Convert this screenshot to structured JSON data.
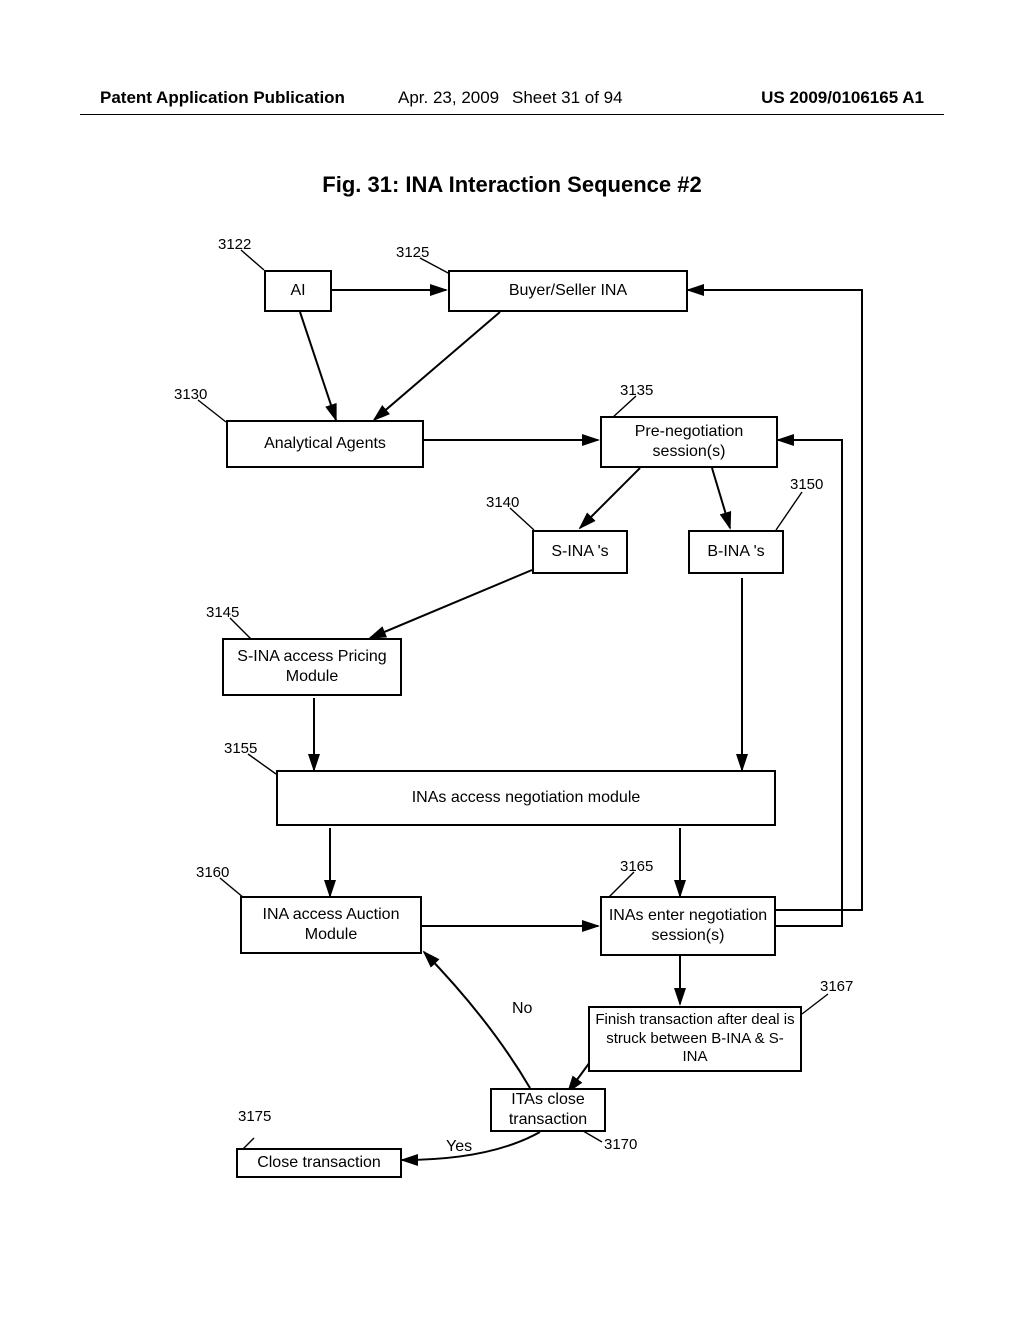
{
  "header": {
    "publication": "Patent Application Publication",
    "date": "Apr. 23, 2009",
    "sheet": "Sheet 31 of 94",
    "number": "US 2009/0106165 A1"
  },
  "title": "Fig. 31: INA Interaction Sequence #2",
  "boxes": {
    "ai": "AI",
    "buyer_seller": "Buyer/Seller INA",
    "analytical": "Analytical Agents",
    "preneg": "Pre-negotiation session(s)",
    "sinas": "S-INA 's",
    "binas": "B-INA 's",
    "sina_pricing": "S-INA access Pricing Module",
    "neg_module": "INAs access negotiation module",
    "auction": "INA access Auction Module",
    "enter_neg": "INAs enter negotiation session(s)",
    "finish": "Finish transaction after deal is struck between B-INA & S-INA",
    "itas_close": "ITAs close transaction",
    "close": "Close transaction"
  },
  "refs": {
    "r3122": "3122",
    "r3125": "3125",
    "r3130": "3130",
    "r3135": "3135",
    "r3140": "3140",
    "r3145": "3145",
    "r3150": "3150",
    "r3155": "3155",
    "r3160": "3160",
    "r3165": "3165",
    "r3167": "3167",
    "r3170": "3170",
    "r3175": "3175"
  },
  "labels": {
    "no": "No",
    "yes": "Yes"
  }
}
